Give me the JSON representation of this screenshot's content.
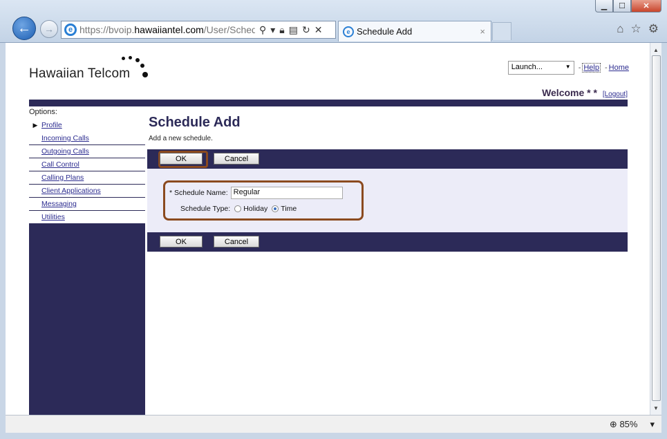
{
  "browser": {
    "url_prefix": "https://bvoip.",
    "url_domain": "hawaiiantel.com",
    "url_path": "/User/Schedu",
    "tab_title": "Schedule Add",
    "tab_close": "×",
    "zoom": "85%"
  },
  "site": {
    "logo_text": "Hawaiian Telcom",
    "launch_select": "Launch...",
    "help_link": "Help",
    "home_link": "Home",
    "separator": "-",
    "welcome_text": "Welcome * *",
    "logout_link": "[Logout]"
  },
  "sidebar": {
    "heading": "Options:",
    "items": [
      {
        "label": "Profile"
      },
      {
        "label": "Incoming Calls"
      },
      {
        "label": "Outgoing Calls"
      },
      {
        "label": "Call Control"
      },
      {
        "label": "Calling Plans"
      },
      {
        "label": "Client Applications"
      },
      {
        "label": "Messaging"
      },
      {
        "label": "Utilities"
      }
    ]
  },
  "page": {
    "title": "Schedule Add",
    "description": "Add a new schedule.",
    "ok_label": "OK",
    "cancel_label": "Cancel"
  },
  "form": {
    "name_label": "* Schedule Name:",
    "name_value": "Regular",
    "type_label": "Schedule Type:",
    "type_options": [
      "Holiday",
      "Time"
    ],
    "type_selected": "Time"
  },
  "colors": {
    "navy": "#2c2a58",
    "highlight": "#8b4a1f",
    "form_bg": "#ececf8"
  }
}
